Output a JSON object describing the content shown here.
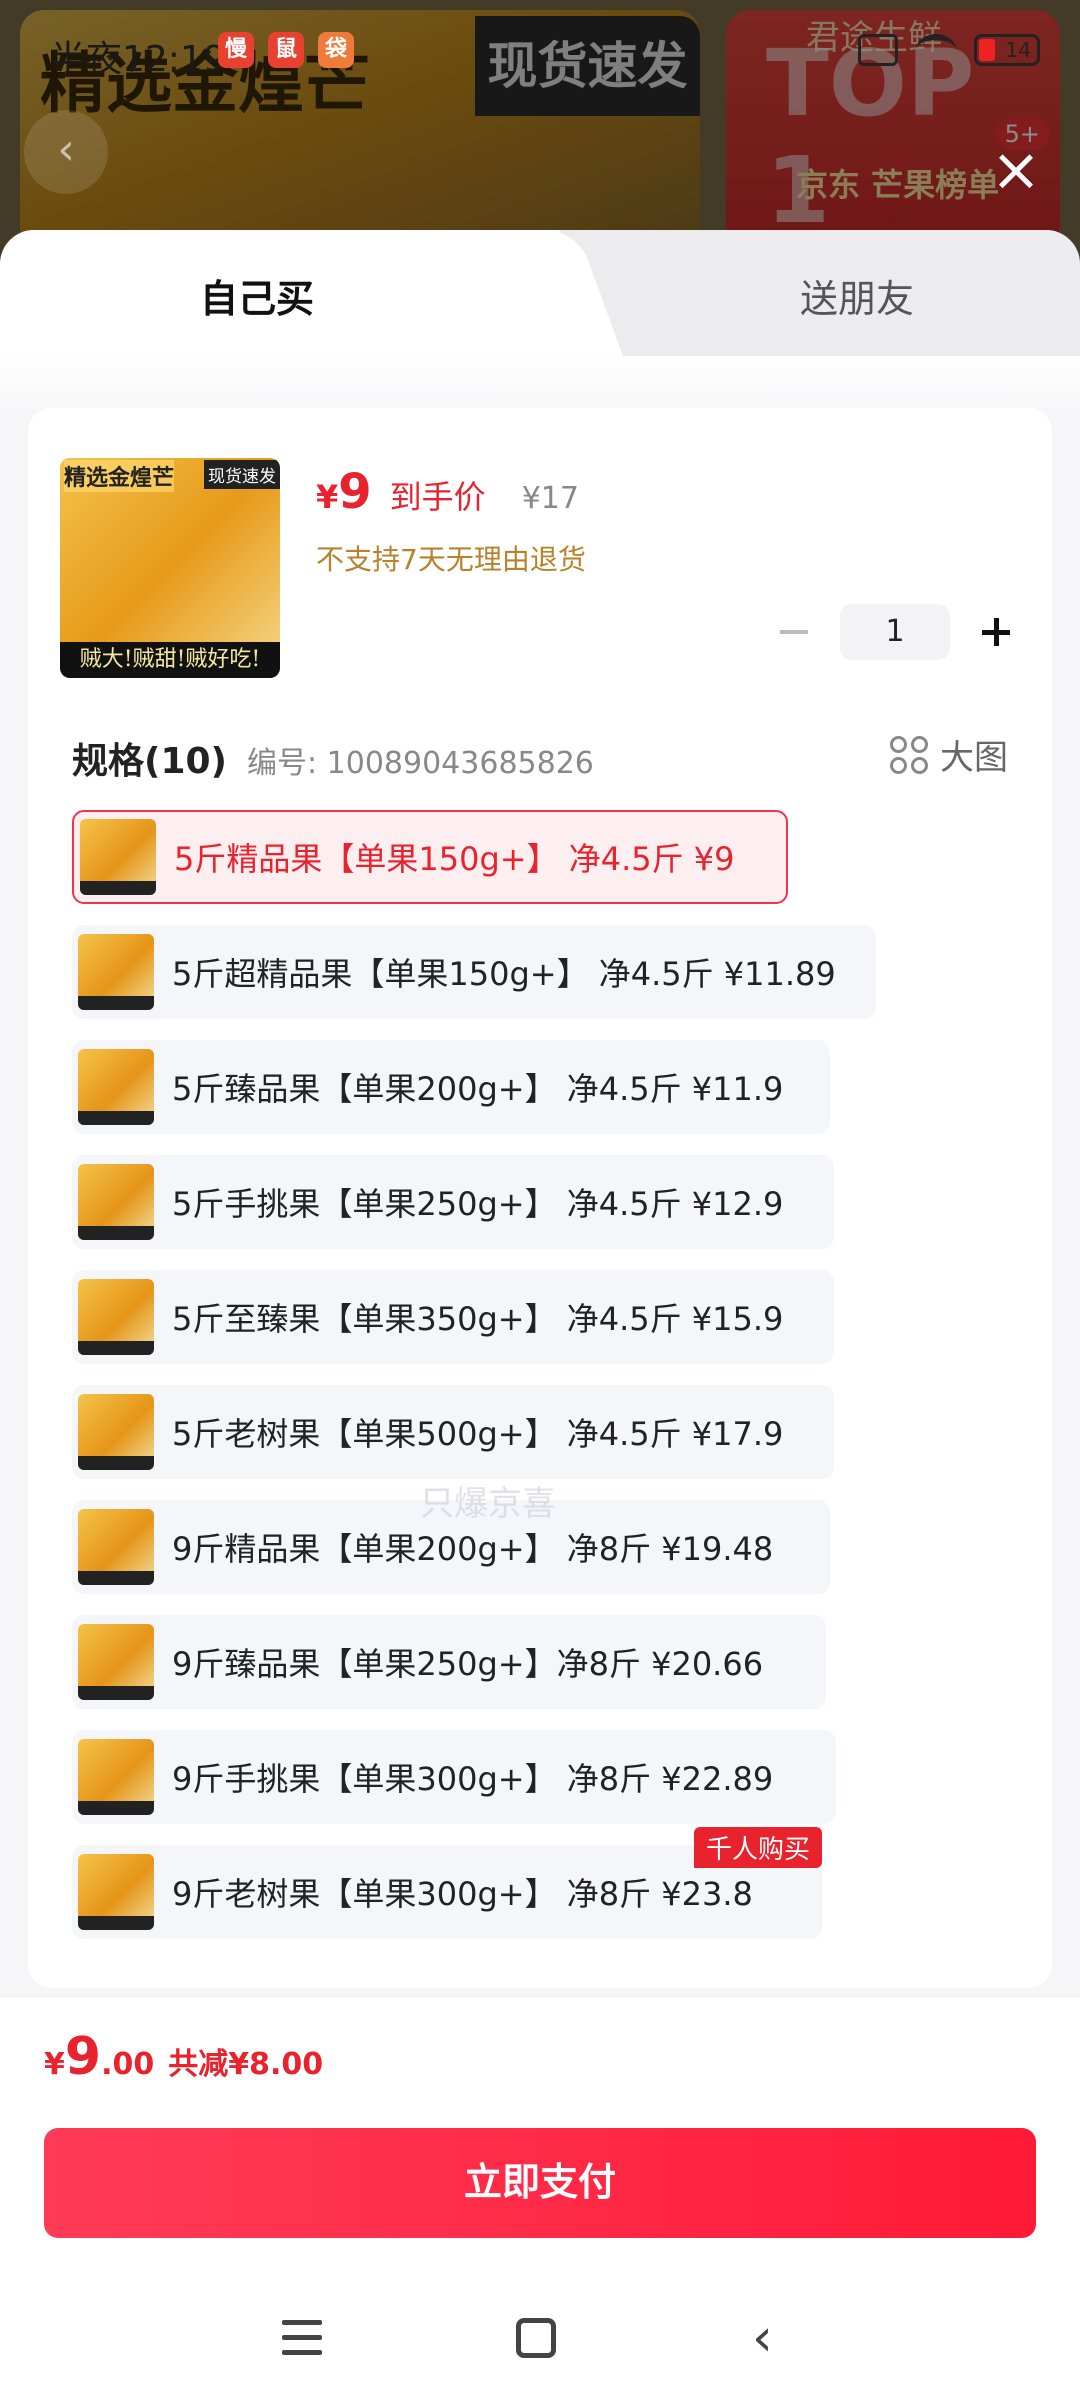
{
  "status_bar": {
    "time": "半夜12:19",
    "app_icon1": "慢",
    "app_icon2": "鼠",
    "app_icon3": "袋",
    "battery": "14"
  },
  "background": {
    "banner_title": "精选金煌芒",
    "banner_tag": "现货速发",
    "top_brand": "君途生鲜",
    "top_text": "TOP 1",
    "top_label": "京东 芒果榜单",
    "badge": "5+"
  },
  "tabs": [
    {
      "label": "自己买",
      "active": true
    },
    {
      "label": "送朋友",
      "active": false
    }
  ],
  "product": {
    "image_title": "精选金煌芒",
    "image_tag": "现货速发",
    "image_caption": "贼大!贼甜!贼好吃!",
    "currency": "¥",
    "price": "9",
    "price_label": "到手价",
    "original_price": "¥17",
    "return_policy": "不支持7天无理由退货",
    "quantity": "1"
  },
  "spec": {
    "title": "规格(10)",
    "code": "编号: 10089043685826",
    "big_image_label": "大图",
    "options": [
      {
        "text": "5斤精品果【单果150g+】 净4.5斤  ¥9",
        "selected": true
      },
      {
        "text": "5斤超精品果【单果150g+】 净4.5斤  ¥11.89",
        "selected": false
      },
      {
        "text": "5斤臻品果【单果200g+】 净4.5斤  ¥11.9",
        "selected": false
      },
      {
        "text": "5斤手挑果【单果250g+】 净4.5斤  ¥12.9",
        "selected": false
      },
      {
        "text": "5斤至臻果【单果350g+】 净4.5斤  ¥15.9",
        "selected": false
      },
      {
        "text": "5斤老树果【单果500g+】 净4.5斤  ¥17.9",
        "selected": false
      },
      {
        "text": "9斤精品果【单果200g+】 净8斤  ¥19.48",
        "selected": false
      },
      {
        "text": "9斤臻品果【单果250g+】净8斤  ¥20.66",
        "selected": false
      },
      {
        "text": "9斤手挑果【单果300g+】 净8斤  ¥22.89",
        "selected": false
      },
      {
        "text": "9斤老树果【单果300g+】 净8斤  ¥23.8",
        "selected": false,
        "tag": "千人购买"
      }
    ]
  },
  "watermark": "只爆京喜",
  "footer": {
    "currency": "¥",
    "total_int": "9",
    "total_dec": ".00",
    "discount": "共减¥8.00",
    "pay_label": "立即支付"
  },
  "colors": {
    "accent": "#e8232e",
    "pay_gradient_start": "#ff3b58",
    "pay_gradient_end": "#ff1a36",
    "warning_text": "#b7822a"
  },
  "icons": {
    "close": "close-icon",
    "grid": "grid-icon",
    "minus": "minus-icon",
    "plus": "plus-icon",
    "nav_menu": "menu-icon",
    "nav_home": "home-icon",
    "nav_back": "back-icon"
  }
}
